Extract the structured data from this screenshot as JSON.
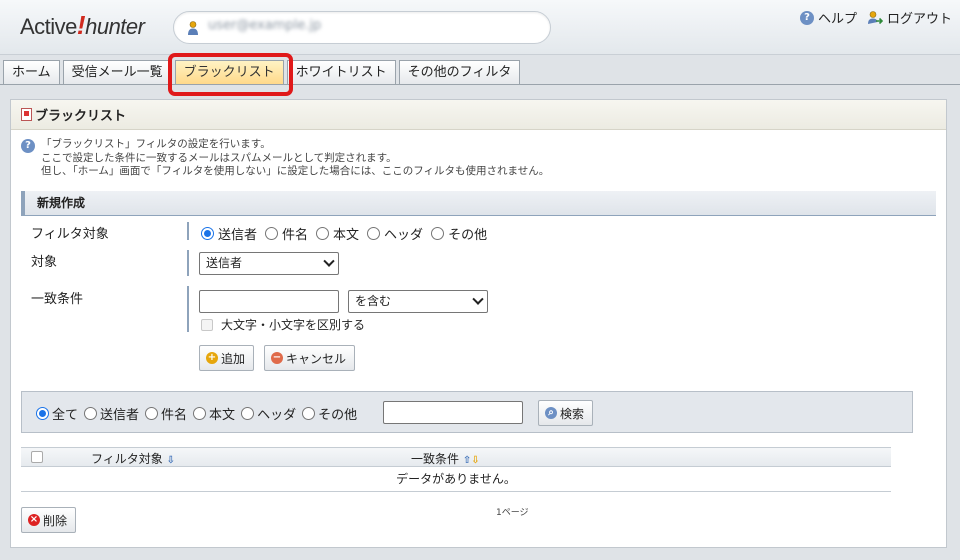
{
  "header": {
    "logo_left": "Active",
    "logo_bang": "!",
    "logo_right": "hunter",
    "user_name": "user@example.jp",
    "help": "ヘルプ",
    "logout": "ログアウト"
  },
  "tabs": [
    {
      "label": "ホーム",
      "active": false
    },
    {
      "label": "受信メール一覧",
      "active": false
    },
    {
      "label": "ブラックリスト",
      "active": true
    },
    {
      "label": "ホワイトリスト",
      "active": false
    },
    {
      "label": "その他のフィルタ",
      "active": false
    }
  ],
  "panel": {
    "title": "ブラックリスト",
    "info": [
      "「ブラックリスト」フィルタの設定を行います。",
      "ここで設定した条件に一致するメールはスパムメールとして判定されます。",
      "但し、「ホーム」画面で「フィルタを使用しない」に設定した場合には、ここのフィルタも使用されません。"
    ],
    "section_title": "新規作成"
  },
  "form": {
    "filter_target_label": "フィルタ対象",
    "filter_target_options": [
      "送信者",
      "件名",
      "本文",
      "ヘッダ",
      "その他"
    ],
    "filter_target_selected": "送信者",
    "target_label": "対象",
    "target_value": "送信者",
    "match_label": "一致条件",
    "match_value": "",
    "match_mode": "を含む",
    "case_label": "大文字・小文字を区別する",
    "add_button": "追加",
    "cancel_button": "キャンセル"
  },
  "search": {
    "options": [
      "全て",
      "送信者",
      "件名",
      "本文",
      "ヘッダ",
      "その他"
    ],
    "selected": "全て",
    "query": "",
    "button": "検索"
  },
  "table": {
    "col_filter": "フィルタ対象",
    "col_match": "一致条件",
    "empty_message": "データがありません。",
    "pager": "1ページ",
    "delete_button": "削除"
  }
}
